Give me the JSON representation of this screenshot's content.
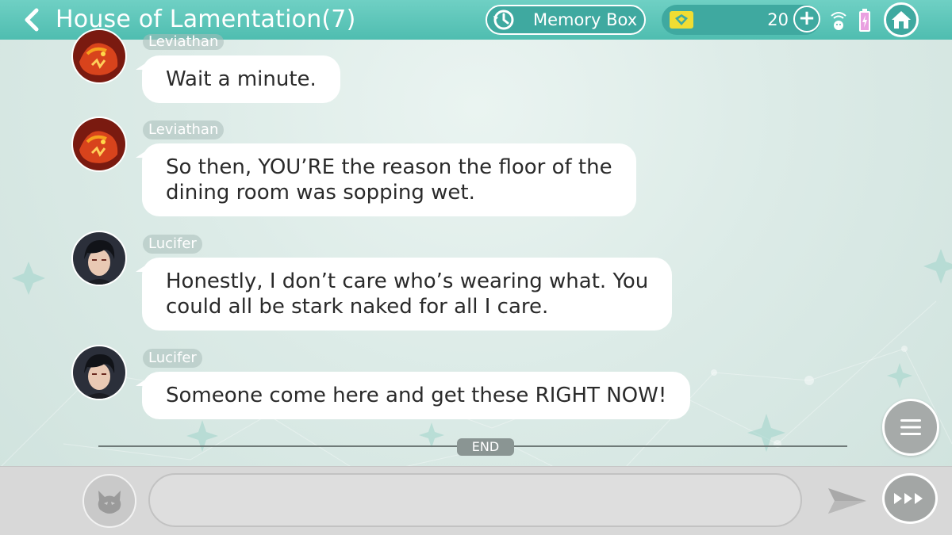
{
  "header": {
    "title": "House of Lamentation(7)",
    "memory_box_label": "Memory Box",
    "currency_count": "20",
    "back_icon": "chevron-left-icon",
    "home_icon": "home-icon"
  },
  "messages": [
    {
      "sender": "Leviathan",
      "text": "Wait a minute.",
      "avatar": "leviathan-avatar"
    },
    {
      "sender": "Leviathan",
      "text_lines": [
        "So then, YOU’RE the reason the floor of the",
        "dining room was sopping wet."
      ],
      "avatar": "leviathan-avatar"
    },
    {
      "sender": "Lucifer",
      "text_lines": [
        "Honestly, I don’t care who’s wearing what. You",
        "could all be stark naked for all I care."
      ],
      "avatar": "lucifer-avatar"
    },
    {
      "sender": "Lucifer",
      "text": "Someone come here and get these RIGHT NOW!",
      "avatar": "lucifer-avatar"
    }
  ],
  "end_label": "END",
  "input": {
    "placeholder": ""
  },
  "colors": {
    "header_bg": "#4fbdb0",
    "bubble_bg": "#ffffff",
    "name_pill_bg": "#b9cbc6",
    "bottom_bar_bg": "#d8d8d8"
  }
}
